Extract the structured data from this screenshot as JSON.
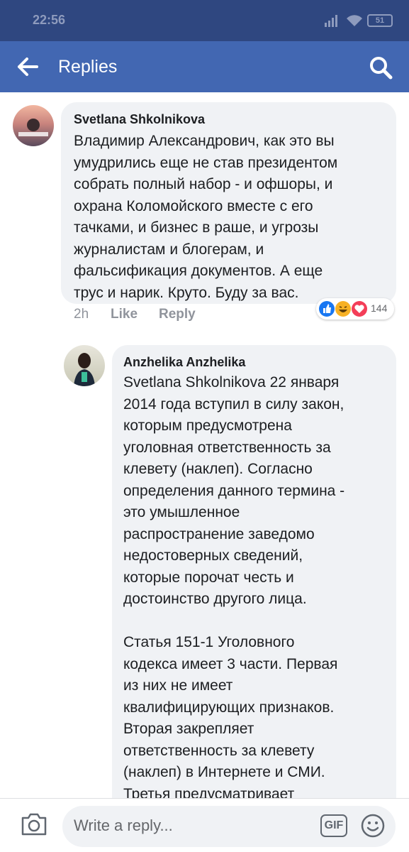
{
  "status_bar": {
    "time": "22:56",
    "battery": "51"
  },
  "app_bar": {
    "title": "Replies"
  },
  "comments": [
    {
      "author": "Svetlana Shkolnikova",
      "text": "Владимир Александрович, как это вы\nумудрились еще не став президентом\nсобрать полный набор - и офшоры, и\nохрана Коломойского вместе с его\nтачками, и бизнес в раше, и угрозы\nжурналистам и блогерам, и\nфальсификация документов. А еще\nтрус и нарик. Круто. Буду за вас.",
      "time": "2h",
      "like_label": "Like",
      "reply_label": "Reply",
      "reaction_count": "144"
    },
    {
      "author": "Anzhelika Anzhelika",
      "text": "Svetlana Shkolnikova 22 января\n2014 года вступил в силу закон,\nкоторым предусмотрена\nуголовная ответственность за\nклевету (наклеп). Согласно\nопределения данного термина -\nэто умышленное\nраспространение заведомо\nнедостоверных сведений,\nкоторые порочат честь и\nдостоинство другого лица.\n\nСтатья 151-1 Уголовного\nкодекса имеет 3 части. Первая\nиз них не имеет\nквалифицирующих признаков.\nВторая закрепляет\nответственность за клевету\n(наклеп) в Интернете и СМИ.\nТретья предусматривает"
    }
  ],
  "composer": {
    "placeholder": "Write a reply...",
    "gif_label": "GIF"
  },
  "colors": {
    "header": "#4267b2",
    "status_bar": "#2f4780",
    "bubble": "#f0f2f5",
    "like": "#1877f2",
    "love": "#f33e58",
    "haha": "#f7b125"
  }
}
